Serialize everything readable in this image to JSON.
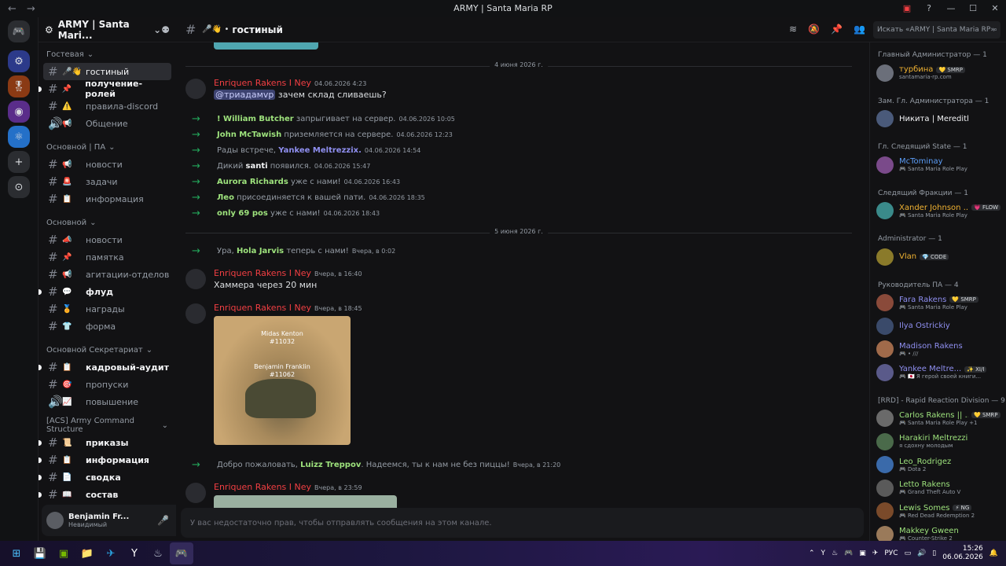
{
  "window": {
    "title": "ARMY | Santa Maria RP"
  },
  "guild": {
    "name": "ARMY | Santa Mari..."
  },
  "channel_header": {
    "name": "гостиный",
    "search_placeholder": "Искать «ARMY | Santa Maria RP»"
  },
  "sidebar": {
    "categories": [
      {
        "label": "Гостевая",
        "channels": [
          {
            "label": "гостиный",
            "emoji": "🎤👋",
            "state": "active"
          },
          {
            "label": "получение-ролей",
            "emoji": "📌",
            "state": "unread"
          },
          {
            "label": "правила-discord",
            "emoji": "⚠️",
            "state": "normal"
          },
          {
            "label": "Общение",
            "emoji": "📢",
            "state": "voice"
          }
        ]
      },
      {
        "label": "Основной | ПА",
        "channels": [
          {
            "label": "новости",
            "emoji": "📢",
            "state": "normal"
          },
          {
            "label": "задачи",
            "emoji": "🚨",
            "state": "normal"
          },
          {
            "label": "информация",
            "emoji": "📋",
            "state": "normal"
          }
        ]
      },
      {
        "label": "Основной",
        "channels": [
          {
            "label": "новости",
            "emoji": "📣",
            "state": "normal"
          },
          {
            "label": "памятка",
            "emoji": "📌",
            "state": "normal"
          },
          {
            "label": "агитации-отделов",
            "emoji": "📢",
            "state": "normal"
          },
          {
            "label": "флуд",
            "emoji": "💬",
            "state": "unread"
          },
          {
            "label": "награды",
            "emoji": "🏅",
            "state": "normal"
          },
          {
            "label": "форма",
            "emoji": "👕",
            "state": "normal"
          }
        ]
      },
      {
        "label": "Основной Секретариат",
        "channels": [
          {
            "label": "кадровый-аудит",
            "emoji": "📋",
            "state": "unread"
          },
          {
            "label": "пропуски",
            "emoji": "🎯",
            "state": "normal"
          },
          {
            "label": "повышение",
            "emoji": "📈",
            "state": "voice"
          }
        ]
      },
      {
        "label": "[ACS] Army Command Structure",
        "channels": [
          {
            "label": "приказы",
            "emoji": "📜",
            "state": "unread"
          },
          {
            "label": "информация",
            "emoji": "📋",
            "state": "unread"
          },
          {
            "label": "сводка",
            "emoji": "📄",
            "state": "unread"
          },
          {
            "label": "состав",
            "emoji": "📖",
            "state": "unread"
          }
        ]
      }
    ]
  },
  "user": {
    "name": "Benjamin Fr...",
    "status": "Невидимый"
  },
  "chat": {
    "date1": "4 июня 2026 г.",
    "msg1": {
      "author": "Enriquen Rakens I Ney",
      "time": "04.06.2026 4:23",
      "mention": "@триадамvp",
      "text": "зачем склад сливаешь?"
    },
    "joins": [
      {
        "pre": "",
        "name": "! William Butcher",
        "post": "запрыгивает на сервер.",
        "time": "04.06.2026 10:05",
        "color": "#9ee37d"
      },
      {
        "pre": "",
        "name": "John McTawish",
        "post": "приземляется на сервере.",
        "time": "04.06.2026 12:23",
        "color": "#9ee37d"
      },
      {
        "pre": "Рады встрече,",
        "name": "Yankee Meltrezzix.",
        "post": "",
        "time": "04.06.2026 14:54",
        "color": "#8f8ff0"
      },
      {
        "pre": "Дикий",
        "name": "santi",
        "post": "появился.",
        "time": "04.06.2026 15:47",
        "color": "#f2f3f5"
      },
      {
        "pre": "",
        "name": "Aurora Richards",
        "post": "уже с нами!",
        "time": "04.06.2026 16:43",
        "color": "#9ee37d"
      },
      {
        "pre": "",
        "name": "Лео",
        "post": "присоединяется к вашей пати.",
        "time": "04.06.2026 18:35",
        "color": "#9ee37d"
      },
      {
        "pre": "",
        "name": "only 69 pos",
        "post": "уже с нами!",
        "time": "04.06.2026 18:43",
        "color": "#9ee37d"
      }
    ],
    "date2": "5 июня 2026 г.",
    "join2": {
      "pre": "Ура,",
      "name": "Hola Jarvis",
      "post": "теперь с нами!",
      "time": "Вчера, в 0:02"
    },
    "msg2": {
      "author": "Enriquen Rakens I Ney",
      "time": "Вчера, в 16:40",
      "text": "Хаммера через 20 мин"
    },
    "msg3": {
      "author": "Enriquen Rakens I Ney",
      "time": "Вчера, в 18:45",
      "image_label1": "Midas Kenton",
      "image_label1b": "#11032",
      "image_label2": "Benjamin Franklin",
      "image_label2b": "#11062"
    },
    "join3": {
      "pre": "Добро пожаловать,",
      "name": "Luizz Treppov",
      "post": ". Надеемся, ты к нам не без пиццы!",
      "time": "Вчера, в 21:20"
    },
    "msg4": {
      "author": "Enriquen Rakens I Ney",
      "time": "Вчера, в 23:59"
    },
    "input_placeholder": "У вас недостаточно прав, чтобы отправлять сообщения на этом канале."
  },
  "members": [
    {
      "role": "Главный Администратор — 1",
      "items": [
        {
          "name": "турбина",
          "sub": "santamaria-rp.com",
          "tag": "💛 SMRP",
          "color": "#f0b232"
        }
      ]
    },
    {
      "role": "Зам. Гл. Администратора — 1",
      "items": [
        {
          "name": "Никита | Meredith",
          "sub": "",
          "tag": "",
          "color": "#f2f3f5"
        }
      ]
    },
    {
      "role": "Гл. Следящий State — 1",
      "items": [
        {
          "name": "McTominay",
          "sub": "🎮 Santa Maria Role Play",
          "tag": "",
          "color": "#5b9cf5"
        }
      ]
    },
    {
      "role": "Следящий Фракции — 1",
      "items": [
        {
          "name": "Xander Johnson ...",
          "sub": "🎮 Santa Maria Role Play",
          "tag": "💗 FLOW",
          "color": "#f0b232"
        }
      ]
    },
    {
      "role": "Administrator — 1",
      "items": [
        {
          "name": "Vlan",
          "sub": "",
          "tag": "💎 CODE",
          "color": "#f0b232"
        }
      ]
    },
    {
      "role": "Руководитель ПА — 4",
      "items": [
        {
          "name": "Fara Rakens",
          "sub": "🎮 Santa Maria Role Play",
          "tag": "💛 SMRP",
          "color": "#8f8ff0"
        },
        {
          "name": "Ilya Ostrickiy",
          "sub": "",
          "tag": "",
          "color": "#8f8ff0"
        },
        {
          "name": "Madison Rakens",
          "sub": "🎮 • ///",
          "tag": "",
          "color": "#8f8ff0"
        },
        {
          "name": "Yankee Meltre...",
          "sub": "🎮 🇯🇵 Я герой своей книги...",
          "tag": "✨ XI/I",
          "color": "#8f8ff0"
        }
      ]
    },
    {
      "role": "[RRD] - Rapid Reaction Division — 9",
      "items": [
        {
          "name": "Carlos Rakens || ...",
          "sub": "🎮 Santa Maria Role Play +1",
          "tag": "💛 SMRP",
          "color": "#9ee37d"
        },
        {
          "name": "Harakiri Meltrezzix",
          "sub": "я сдохну молодым",
          "tag": "",
          "color": "#9ee37d"
        },
        {
          "name": "Leo_Rodrigez",
          "sub": "🎮 Dota 2",
          "tag": "",
          "color": "#9ee37d"
        },
        {
          "name": "Letto Rakens",
          "sub": "🎮 Grand Theft Auto V",
          "tag": "",
          "color": "#9ee37d"
        },
        {
          "name": "Lewis Somes",
          "sub": "🎮 Red Dead Redemption 2",
          "tag": "⚡ NG",
          "color": "#9ee37d"
        },
        {
          "name": "Makkey Gween",
          "sub": "🎮 Counter-Strike 2",
          "tag": "",
          "color": "#9ee37d"
        }
      ]
    }
  ],
  "taskbar": {
    "lang": "РУС",
    "time": "15:26",
    "date": "06.06.2026"
  }
}
